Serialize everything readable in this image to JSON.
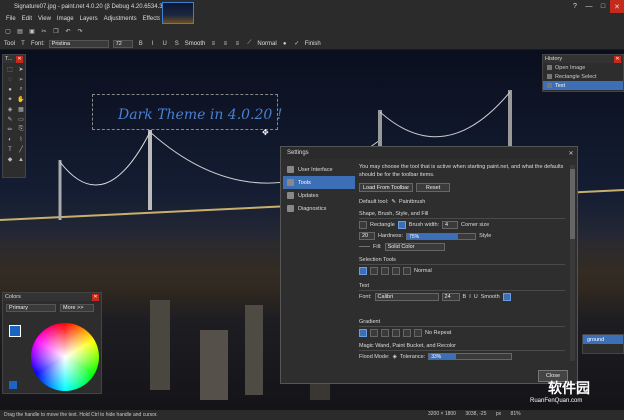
{
  "window": {
    "title": "Signature07.jpg - paint.net 4.0.20 (β Debug 4.20.6534.3685)"
  },
  "menu": [
    "File",
    "Edit",
    "View",
    "Image",
    "Layers",
    "Adjustments",
    "Effects"
  ],
  "toolbar": {
    "tool_label": "Tool",
    "font_label": "Font:",
    "font_value": "Pristina",
    "size_value": "72",
    "smoothing": "Smooth",
    "blend": "Normal",
    "finish": "Finish"
  },
  "canvas_text": "Dark Theme in 4.0.20 !",
  "tools_panel": {
    "title": "T..."
  },
  "history": {
    "title": "History",
    "items": [
      "Open Image",
      "Rectangle Select",
      "Text"
    ]
  },
  "colors": {
    "title": "Colors",
    "mode": "Primary",
    "more": "More >>"
  },
  "layers": {
    "label": "ground"
  },
  "settings": {
    "title": "Settings",
    "nav": [
      "User Interface",
      "Tools",
      "Updates",
      "Diagnostics"
    ],
    "intro": "You may choose the tool that is active when starting paint.net, and what the defaults should be for the toolbar items.",
    "load_btn": "Load From Toolbar",
    "reset_btn": "Reset",
    "default_tool_label": "Default tool:",
    "default_tool_value": "Paintbrush",
    "shape_section": "Shape, Brush, Style, and Fill",
    "shape_value": "Rectangle",
    "brush_width_label": "Brush width:",
    "brush_width_value": "4",
    "corner_label": "Corner size",
    "corner_value": "20",
    "hardness_label": "Hardness:",
    "hardness_value": "75%",
    "style_label": "Style",
    "fill_label": "Fill:",
    "fill_value": "Solid Color",
    "selection_section": "Selection Tools",
    "selection_mode": "Normal",
    "text_section": "Text",
    "font_label": "Font:",
    "font_value": "Calibri",
    "font_size": "24",
    "smoothing": "Smooth",
    "gradient_section": "Gradient",
    "gradient_repeat": "No Repeat",
    "magic_section": "Magic Wand, Paint Bucket, and Recolor",
    "flood_label": "Flood Mode:",
    "tolerance_label": "Tolerance:",
    "tolerance_value": "33%",
    "close_btn": "Close"
  },
  "status": {
    "hint": "Drag the handle to move the text. Hold Ctrl to hide handle and cursor.",
    "size": "3200 × 1800",
    "pos": "3038, -25",
    "unit": "px",
    "zoom": "81%"
  },
  "watermark": {
    "cn": "软件园",
    "url": "RuanFenQuan.com"
  },
  "icons": [
    "close-icon",
    "minimize-icon",
    "maximize-icon",
    "paintbrush-icon",
    "bold-icon",
    "italic-icon",
    "underline-icon",
    "strike-icon",
    "align-icon",
    "eyedropper-icon",
    "bucket-icon"
  ],
  "accent": "#3d6fb6"
}
